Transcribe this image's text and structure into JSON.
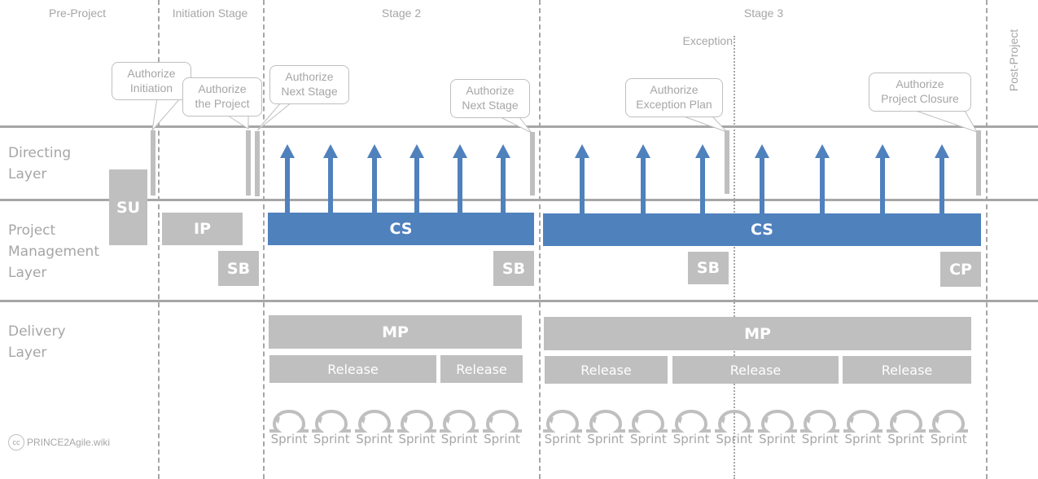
{
  "stages": {
    "pre_project": "Pre-Project",
    "initiation": "Initiation Stage",
    "stage2": "Stage 2",
    "stage3": "Stage 3",
    "post_project": "Post-Project",
    "exception": "Exception"
  },
  "layers": {
    "directing": [
      "Directing",
      "Layer"
    ],
    "management": [
      "Project",
      "Management",
      "Layer"
    ],
    "delivery": [
      "Delivery",
      "Layer"
    ]
  },
  "callouts": {
    "authorize_initiation": [
      "Authorize",
      "Initiation"
    ],
    "authorize_project": [
      "Authorize",
      "the Project"
    ],
    "authorize_next_stage_1": [
      "Authorize",
      "Next Stage"
    ],
    "authorize_next_stage_2": [
      "Authorize",
      "Next Stage"
    ],
    "authorize_exception_plan": [
      "Authorize",
      "Exception Plan"
    ],
    "authorize_closure": [
      "Authorize",
      "Project Closure"
    ]
  },
  "processes": {
    "su": "SU",
    "ip": "IP",
    "sb1": "SB",
    "cs1": "CS",
    "sb2": "SB",
    "cs2": "CS",
    "sb3": "SB",
    "cp": "CP"
  },
  "delivery": {
    "mp1": "MP",
    "mp2": "MP",
    "releases_stage2": [
      "Release",
      "Release"
    ],
    "releases_stage3": [
      "Release",
      "Release",
      "Release"
    ],
    "sprint_label": "Sprint",
    "sprints_stage2": [
      "Sprint",
      "Sprint",
      "Sprint",
      "Sprint",
      "Sprint",
      "Sprint"
    ],
    "sprints_stage3": [
      "Sprint",
      "Sprint",
      "Sprint",
      "Sprint",
      "Sprint",
      "Sprint",
      "Sprint",
      "Sprint",
      "Sprint",
      "Sprint"
    ]
  },
  "footer": {
    "cc_icon": "cc",
    "site": "PRINCE2Agile.wiki"
  },
  "colors": {
    "blue": "#4f81bd",
    "gray": "#bfbfbf",
    "line": "#a6a6a6"
  }
}
